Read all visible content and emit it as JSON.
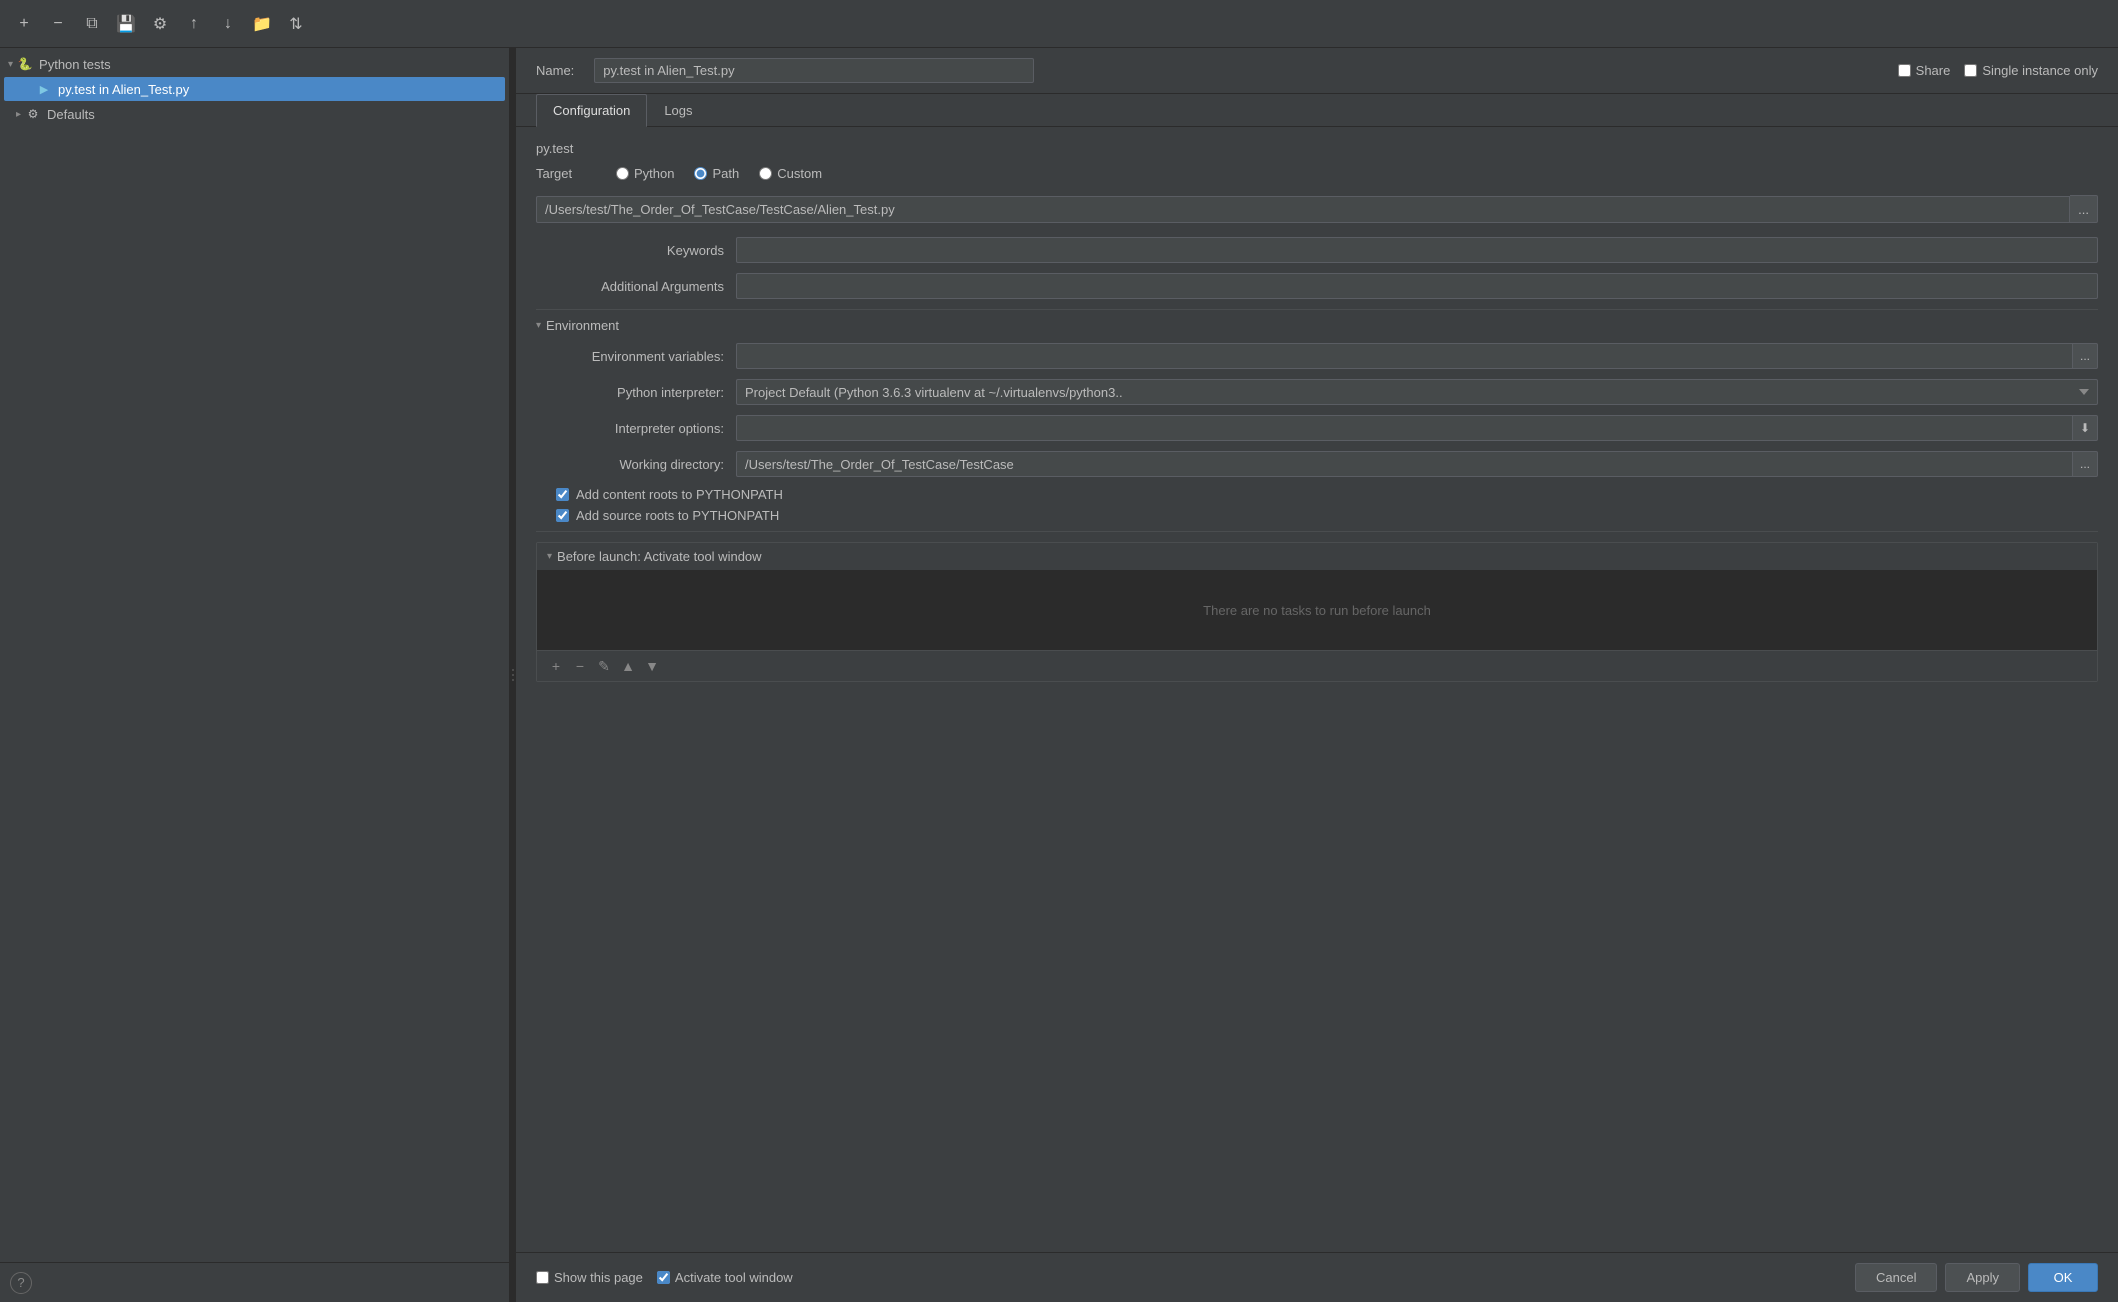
{
  "toolbar": {
    "add_label": "+",
    "remove_label": "−",
    "copy_label": "⧉",
    "save_label": "💾",
    "gear_label": "⚙",
    "arrow_up_label": "↑",
    "arrow_down_label": "↓",
    "folder_label": "📁",
    "sort_label": "⇅"
  },
  "sidebar": {
    "group_label": "Python tests",
    "item_label": "py.test in Alien_Test.py",
    "defaults_label": "Defaults"
  },
  "header": {
    "name_label": "Name:",
    "name_value": "py.test in Alien_Test.py",
    "share_label": "Share",
    "single_instance_label": "Single instance only"
  },
  "tabs": {
    "configuration_label": "Configuration",
    "logs_label": "Logs"
  },
  "config": {
    "pytest_label": "py.test",
    "target_label": "Target",
    "target_python_label": "Python",
    "target_path_label": "Path",
    "target_custom_label": "Custom",
    "path_value": "/Users/test/The_Order_Of_TestCase/TestCase/Alien_Test.py",
    "keywords_label": "Keywords",
    "keywords_value": "",
    "additional_args_label": "Additional Arguments",
    "additional_args_value": "",
    "environment_label": "Environment",
    "env_variables_label": "Environment variables:",
    "env_variables_value": "",
    "python_interpreter_label": "Python interpreter:",
    "python_interpreter_value": "Project Default (Python 3.6.3 virtualenv at ~/.virtualenvs/python3..",
    "interpreter_options_label": "Interpreter options:",
    "interpreter_options_value": "",
    "working_directory_label": "Working directory:",
    "working_directory_value": "/Users/test/The_Order_Of_TestCase/TestCase",
    "add_content_roots_label": "Add content roots to PYTHONPATH",
    "add_source_roots_label": "Add source roots to PYTHONPATH",
    "before_launch_label": "Before launch: Activate tool window",
    "no_tasks_label": "There are no tasks to run before launch",
    "show_this_page_label": "Show this page",
    "activate_tool_window_label": "Activate tool window"
  },
  "buttons": {
    "cancel_label": "Cancel",
    "apply_label": "Apply",
    "ok_label": "OK"
  },
  "icons": {
    "browse": "...",
    "chevron_down": "▾",
    "chevron_right": "▸",
    "plus": "+",
    "minus": "−",
    "edit": "✎",
    "up": "▲",
    "down": "▼",
    "question": "?",
    "download": "⬇"
  }
}
